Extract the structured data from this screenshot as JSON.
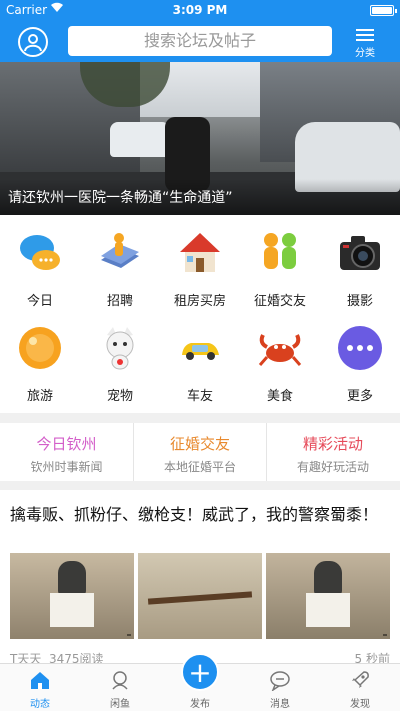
{
  "status_bar": {
    "carrier": "Carrier",
    "time": "3:09 PM"
  },
  "header": {
    "search_placeholder": "搜索论坛及帖子",
    "menu_label": "分类",
    "accent_color": "#1e90f0"
  },
  "banner": {
    "caption": "请还钦州一医院一条畅通“生命通道”"
  },
  "grid": [
    {
      "label": "今日",
      "icon": "speech-bubbles-icon"
    },
    {
      "label": "招聘",
      "icon": "books-person-icon"
    },
    {
      "label": "租房买房",
      "icon": "house-icon"
    },
    {
      "label": "征婚交友",
      "icon": "couple-icon"
    },
    {
      "label": "摄影",
      "icon": "camera-icon"
    },
    {
      "label": "旅游",
      "icon": "orange-ball-icon"
    },
    {
      "label": "宠物",
      "icon": "cat-icon"
    },
    {
      "label": "车友",
      "icon": "car-icon"
    },
    {
      "label": "美食",
      "icon": "crab-icon"
    },
    {
      "label": "更多",
      "icon": "more-dots-icon"
    }
  ],
  "channels": [
    {
      "title": "今日钦州",
      "subtitle": "钦州时事新闻",
      "color": "#d35ec9"
    },
    {
      "title": "征婚交友",
      "subtitle": "本地征婚平台",
      "color": "#e88a2f"
    },
    {
      "title": "精彩活动",
      "subtitle": "有趣好玩活动",
      "color": "#e64b5a"
    }
  ],
  "article": {
    "title": "擒毒贩、抓粉仔、缴枪支！威武了，我的警察蜀黍！",
    "author": "T天天",
    "reads": "3475阅读",
    "time": "5 秒前"
  },
  "tabbar": {
    "items": [
      {
        "label": "动态",
        "icon": "home-icon",
        "active": true
      },
      {
        "label": "闲鱼",
        "icon": "fish-icon",
        "active": false
      },
      {
        "label": "发布",
        "icon": "plus-icon",
        "active": false
      },
      {
        "label": "消息",
        "icon": "message-icon",
        "active": false
      },
      {
        "label": "发现",
        "icon": "rocket-icon",
        "active": false
      }
    ]
  }
}
